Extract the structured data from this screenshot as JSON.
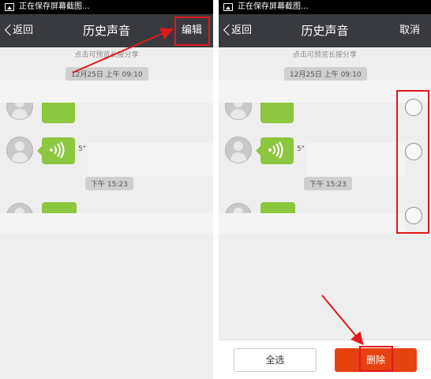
{
  "status_bar": {
    "text": "正在保存屏幕截图..."
  },
  "left": {
    "back_label": "返回",
    "title": "历史声音",
    "edit_label": "编辑",
    "hint": "点击可预览长按分享",
    "date_time": "12月25日 上午 09:10",
    "message_duration": "5\"",
    "afternoon_time": "下午 15:23"
  },
  "right": {
    "back_label": "返回",
    "title": "历史声音",
    "cancel_label": "取消",
    "hint": "点击可预览长按分享",
    "date_time": "12月25日 上午 09:10",
    "message_duration": "5\"",
    "afternoon_time": "下午 15:23",
    "select_all_label": "全选",
    "delete_label": "删除"
  },
  "colors": {
    "title_bar": "#393a3f",
    "voice_bubble": "#8dc63f",
    "delete_button": "#e64210",
    "highlight": "#e0181b"
  }
}
